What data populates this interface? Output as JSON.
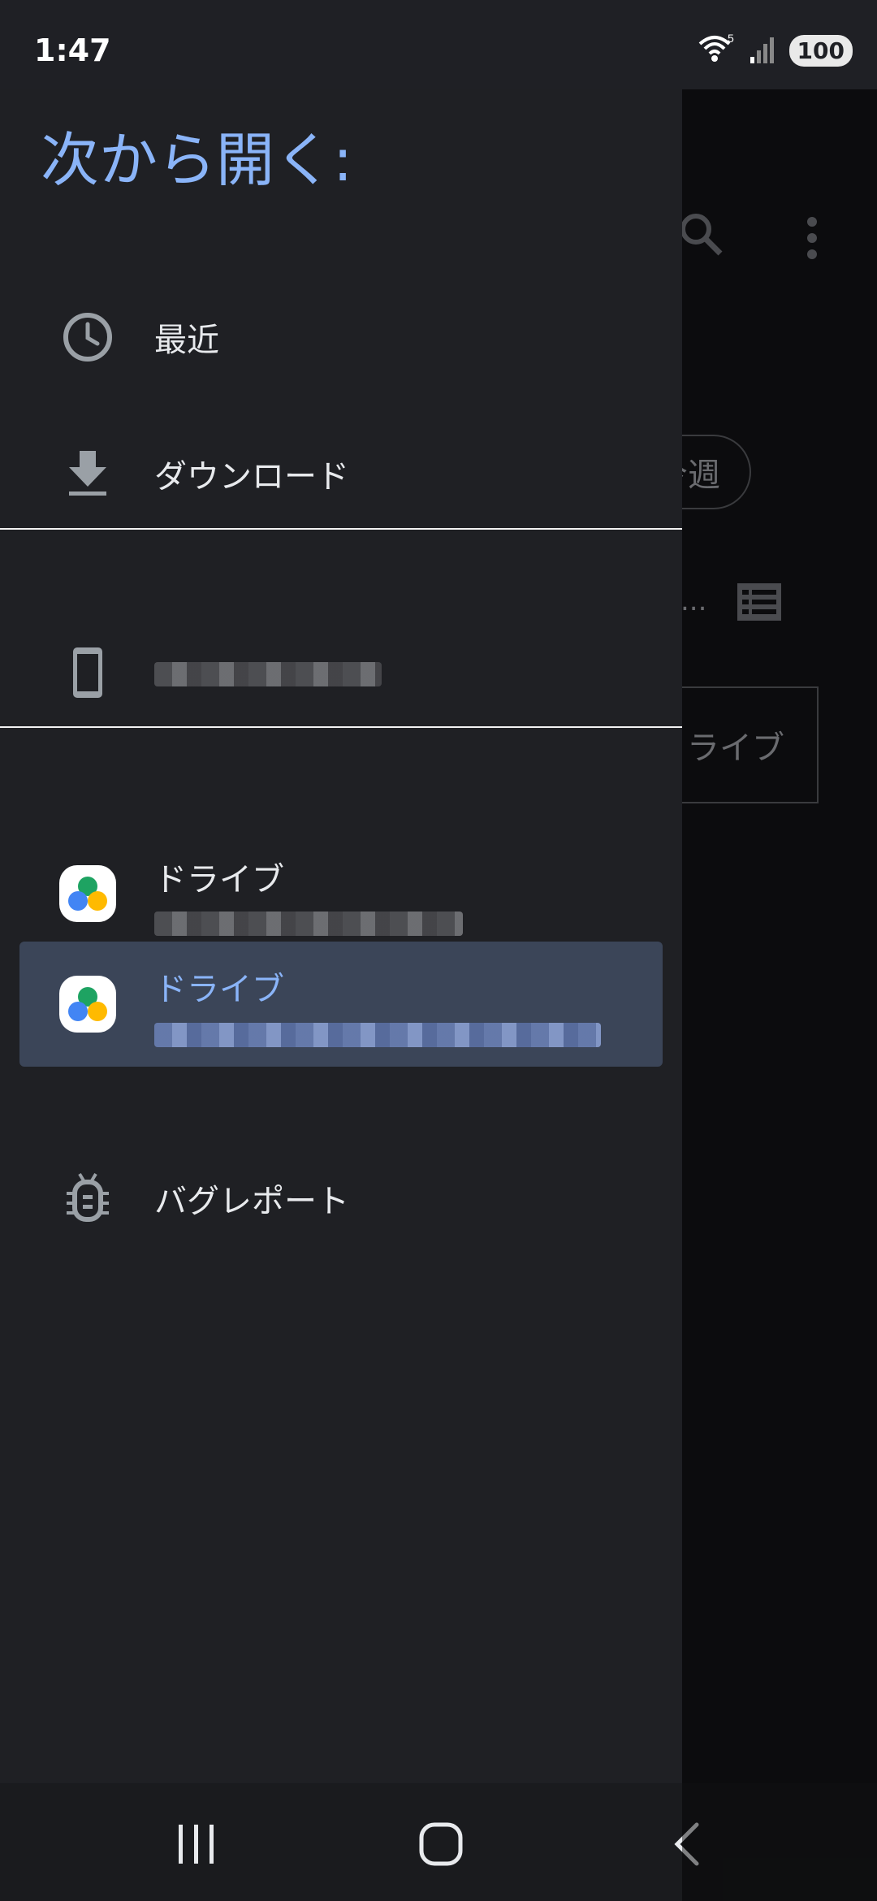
{
  "status_bar": {
    "time": "1:47",
    "battery": "100",
    "wifi_badge": "5"
  },
  "background_app": {
    "chip_label": "今週",
    "ellipsis": "...",
    "drive_box_label": "ライブ"
  },
  "drawer": {
    "title": "次から開く:",
    "items": [
      {
        "label": "最近",
        "icon": "clock-icon"
      },
      {
        "label": "ダウンロード",
        "icon": "download-icon"
      }
    ],
    "device": {
      "icon": "phone-icon"
    },
    "accounts": [
      {
        "label": "ドライブ",
        "icon": "google-drive-icon",
        "selected": false
      },
      {
        "label": "ドライブ",
        "icon": "google-drive-icon",
        "selected": true
      }
    ],
    "bug_report": {
      "label": "バグレポート",
      "icon": "bug-icon"
    }
  },
  "nav": [
    "recents-button",
    "home-button",
    "back-button"
  ],
  "colors": {
    "accent": "#8ab4f8",
    "drawer_bg": "#1f2024",
    "selected_bg": "#3b4558"
  }
}
